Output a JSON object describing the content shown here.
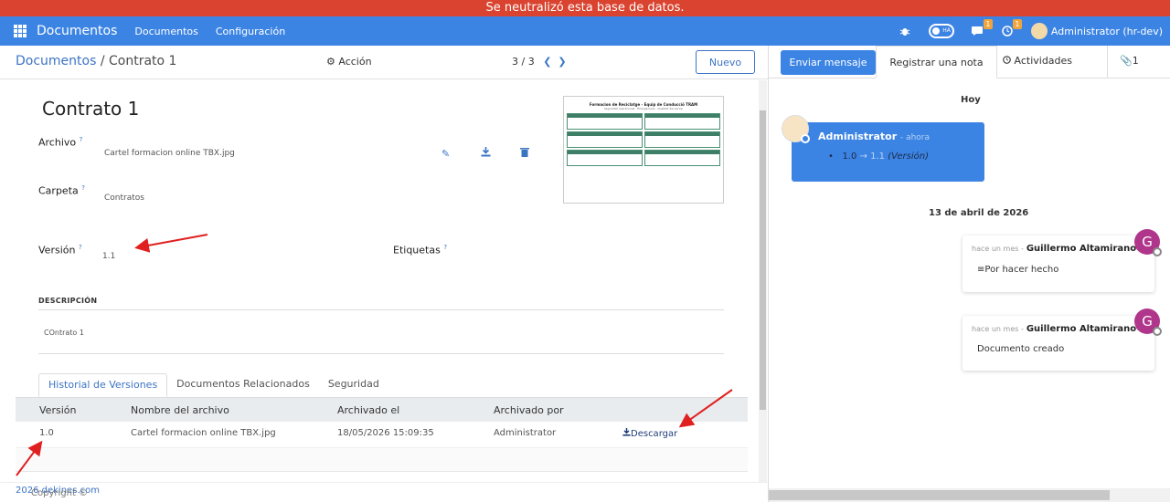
{
  "banner": {
    "text": "Se neutralizó esta base de datos."
  },
  "navbar": {
    "brand": "Documentos",
    "menu": [
      "Documentos",
      "Configuración"
    ],
    "toggle_label": "HA",
    "messages_badge": "1",
    "activities_badge": "1",
    "user": "Administrator (hr-dev)"
  },
  "control": {
    "breadcrumb_parent": "Documentos",
    "breadcrumb_sep": "/",
    "breadcrumb_current": "Contrato 1",
    "action": "Acción",
    "pager": "3 / 3",
    "new_button": "Nuevo"
  },
  "form": {
    "title": "Contrato 1",
    "archivo_label": "Archivo",
    "archivo_value": "Cartel formacion online TBX.jpg",
    "carpeta_label": "Carpeta",
    "carpeta_value": "Contratos",
    "version_label": "Versión",
    "version_value": "1.1",
    "etiquetas_label": "Etiquetas",
    "help_mark": "?",
    "description_header": "DESCRIPCIÓN",
    "description_text": "COntrato 1"
  },
  "thumbnail": {
    "title": "Formacion de Reciclatge - Equip de Conducció TRAM",
    "subtitle": "Seguretat operacional · Emergències · Qualitat del servei"
  },
  "tabs": [
    {
      "label": "Historial de Versiones",
      "active": true
    },
    {
      "label": "Documentos Relacionados",
      "active": false
    },
    {
      "label": "Seguridad",
      "active": false
    }
  ],
  "table": {
    "headers": [
      "Versión",
      "Nombre del archivo",
      "Archivado el",
      "Archivado por"
    ],
    "rows": [
      {
        "version": "1.0",
        "filename": "Cartel formacion online TBX.jpg",
        "archived_on": "18/05/2026 15:09:35",
        "archived_by": "Administrator",
        "action": "Descargar"
      }
    ]
  },
  "footer": {
    "prefix": "Copyright ©",
    "link": "2026 dekines.com"
  },
  "chatter": {
    "send_message": "Enviar mensaje",
    "log_note": "Registrar una nota",
    "activities": "Actividades",
    "attachments_count": "1",
    "day_today": "Hoy",
    "message1": {
      "author": "Administrator",
      "when": "- ahora",
      "old": "1.0",
      "arrow": "→",
      "new": "1.1",
      "field": "(Versión)"
    },
    "day_past": "13 de abril de 2026",
    "message2": {
      "when": "hace un mes -",
      "author": "Guillermo Altamirano",
      "body": "Por hacer hecho",
      "avatar": "G"
    },
    "message3": {
      "when": "hace un mes -",
      "author": "Guillermo Altamirano",
      "body": "Documento creado",
      "avatar": "G"
    }
  },
  "colors": {
    "banner": "#d9432f",
    "navbar": "#3c84e4",
    "link": "#3c74c4",
    "annotation_arrow": "#e02020"
  }
}
